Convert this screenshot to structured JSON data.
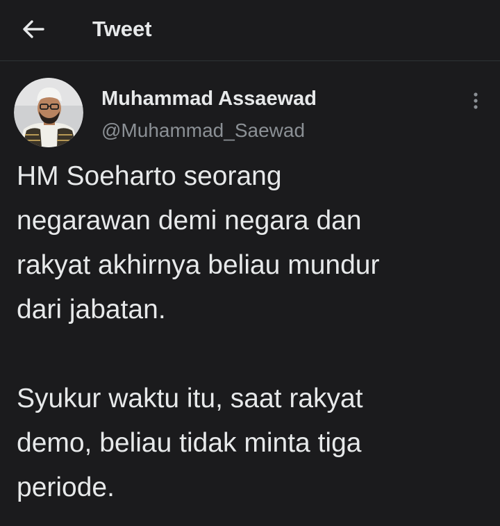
{
  "header": {
    "title": "Tweet",
    "back_icon": "arrow-left-icon"
  },
  "author": {
    "display_name": "Muhammad Assaewad",
    "handle": "@Muhammad_Saewad",
    "avatar_icon": "profile-photo",
    "menu_icon": "more-vertical-icon"
  },
  "tweet": {
    "text": "HM Soeharto seorang\nnegarawan demi negara dan\nrakyat akhirnya beliau mundur\ndari jabatan.\n\nSyukur waktu itu, saat rakyat\ndemo, beliau tidak minta tiga\nperiode."
  },
  "colors": {
    "background": "#1b1b1d",
    "text_primary": "#e7e9ea",
    "text_secondary": "#8b9095",
    "divider": "#2f3336"
  }
}
